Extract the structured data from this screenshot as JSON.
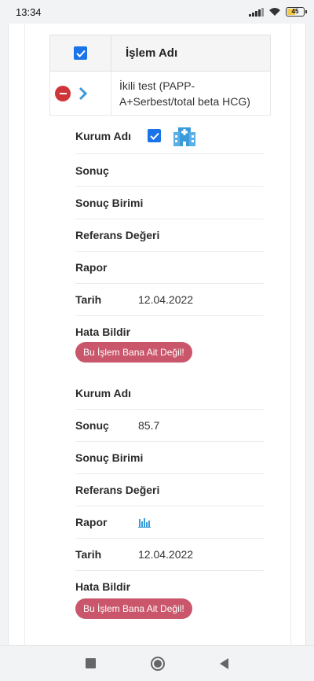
{
  "status_bar": {
    "time": "13:34",
    "battery": "45"
  },
  "table": {
    "header_title": "İşlem Adı",
    "row_title": "İkili test (PAPP-A+Serbest/total beta HCG)"
  },
  "details": [
    {
      "kurum_adi_label": "Kurum Adı",
      "sonuc_label": "Sonuç",
      "sonuc_value": "",
      "sonuc_birimi_label": "Sonuç Birimi",
      "referans_label": "Referans Değeri",
      "rapor_label": "Rapor",
      "tarih_label": "Tarih",
      "tarih_value": "12.04.2022",
      "hata_label": "Hata Bildir",
      "hata_button": "Bu İşlem Bana Ait Değil!"
    },
    {
      "kurum_adi_label": "Kurum Adı",
      "sonuc_label": "Sonuç",
      "sonuc_value": "85.7",
      "sonuc_birimi_label": "Sonuç Birimi",
      "referans_label": "Referans Değeri",
      "rapor_label": "Rapor",
      "tarih_label": "Tarih",
      "tarih_value": "12.04.2022",
      "hata_label": "Hata Bildir",
      "hata_button": "Bu İşlem Bana Ait Değil!"
    }
  ],
  "icons": {
    "hospital": "hospital-icon",
    "report": "bar-chart-icon"
  },
  "colors": {
    "checkbox": "#1a73e8",
    "remove": "#d13438",
    "report_button": "#c9566a",
    "expand_chevron": "#3b9ad9"
  }
}
